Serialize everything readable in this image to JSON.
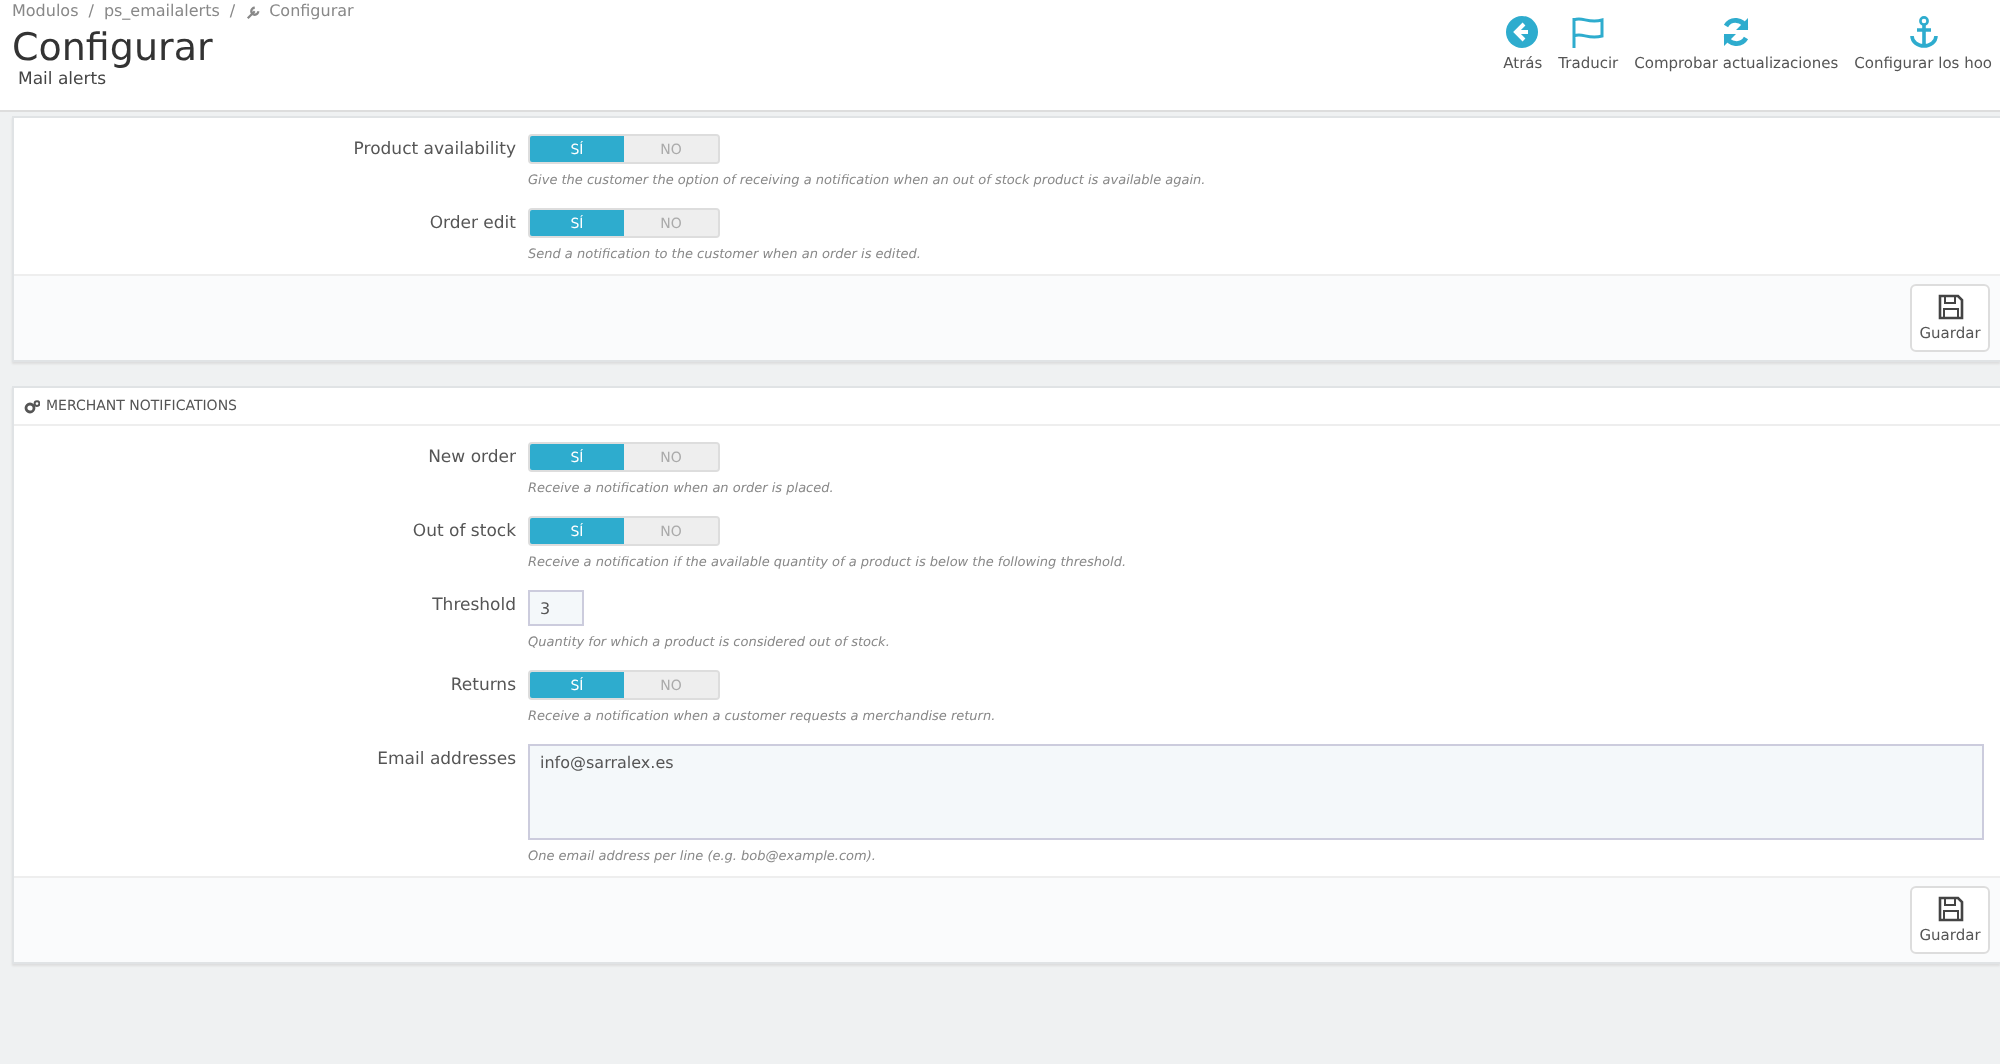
{
  "breadcrumb": [
    "Modulos",
    "ps_emailalerts",
    "Configurar"
  ],
  "breadcrumb_separator": "/",
  "page_title": "Configurar",
  "page_subtitle": "Mail alerts",
  "toolbar": [
    {
      "kind": "back",
      "label": "Atrás"
    },
    {
      "kind": "flag",
      "label": "Traducir"
    },
    {
      "kind": "refresh",
      "label": "Comprobar actualizaciones"
    },
    {
      "kind": "anchor",
      "label": "Configurar los hoo"
    }
  ],
  "panels": [
    {
      "fields": [
        {
          "kind": "switch",
          "label": "Product availability",
          "options": [
            {
              "label": "SÍ",
              "selected": true
            },
            {
              "label": "NO",
              "selected": false
            }
          ],
          "help": "Give the customer the option of receiving a notification when an out of stock product is available again."
        },
        {
          "kind": "switch",
          "label": "Order edit",
          "options": [
            {
              "label": "SÍ",
              "selected": true
            },
            {
              "label": "NO",
              "selected": false
            }
          ],
          "help": "Send a notification to the customer when an order is edited."
        }
      ],
      "save_label": "Guardar"
    },
    {
      "heading": "MERCHANT NOTIFICATIONS",
      "fields": [
        {
          "kind": "switch",
          "label": "New order",
          "options": [
            {
              "label": "SÍ",
              "selected": true
            },
            {
              "label": "NO",
              "selected": false
            }
          ],
          "help": "Receive a notification when an order is placed."
        },
        {
          "kind": "switch",
          "label": "Out of stock",
          "options": [
            {
              "label": "SÍ",
              "selected": true
            },
            {
              "label": "NO",
              "selected": false
            }
          ],
          "help": "Receive a notification if the available quantity of a product is below the following threshold."
        },
        {
          "kind": "input",
          "label": "Threshold",
          "value": "3",
          "help": "Quantity for which a product is considered out of stock."
        },
        {
          "kind": "switch",
          "label": "Returns",
          "options": [
            {
              "label": "SÍ",
              "selected": true
            },
            {
              "label": "NO",
              "selected": false
            }
          ],
          "help": "Receive a notification when a customer requests a merchandise return."
        },
        {
          "kind": "textarea",
          "label": "Email addresses",
          "value": "info@sarralex.es",
          "help": "One email address per line (e.g. bob@example.com)."
        }
      ],
      "save_label": "Guardar"
    }
  ]
}
